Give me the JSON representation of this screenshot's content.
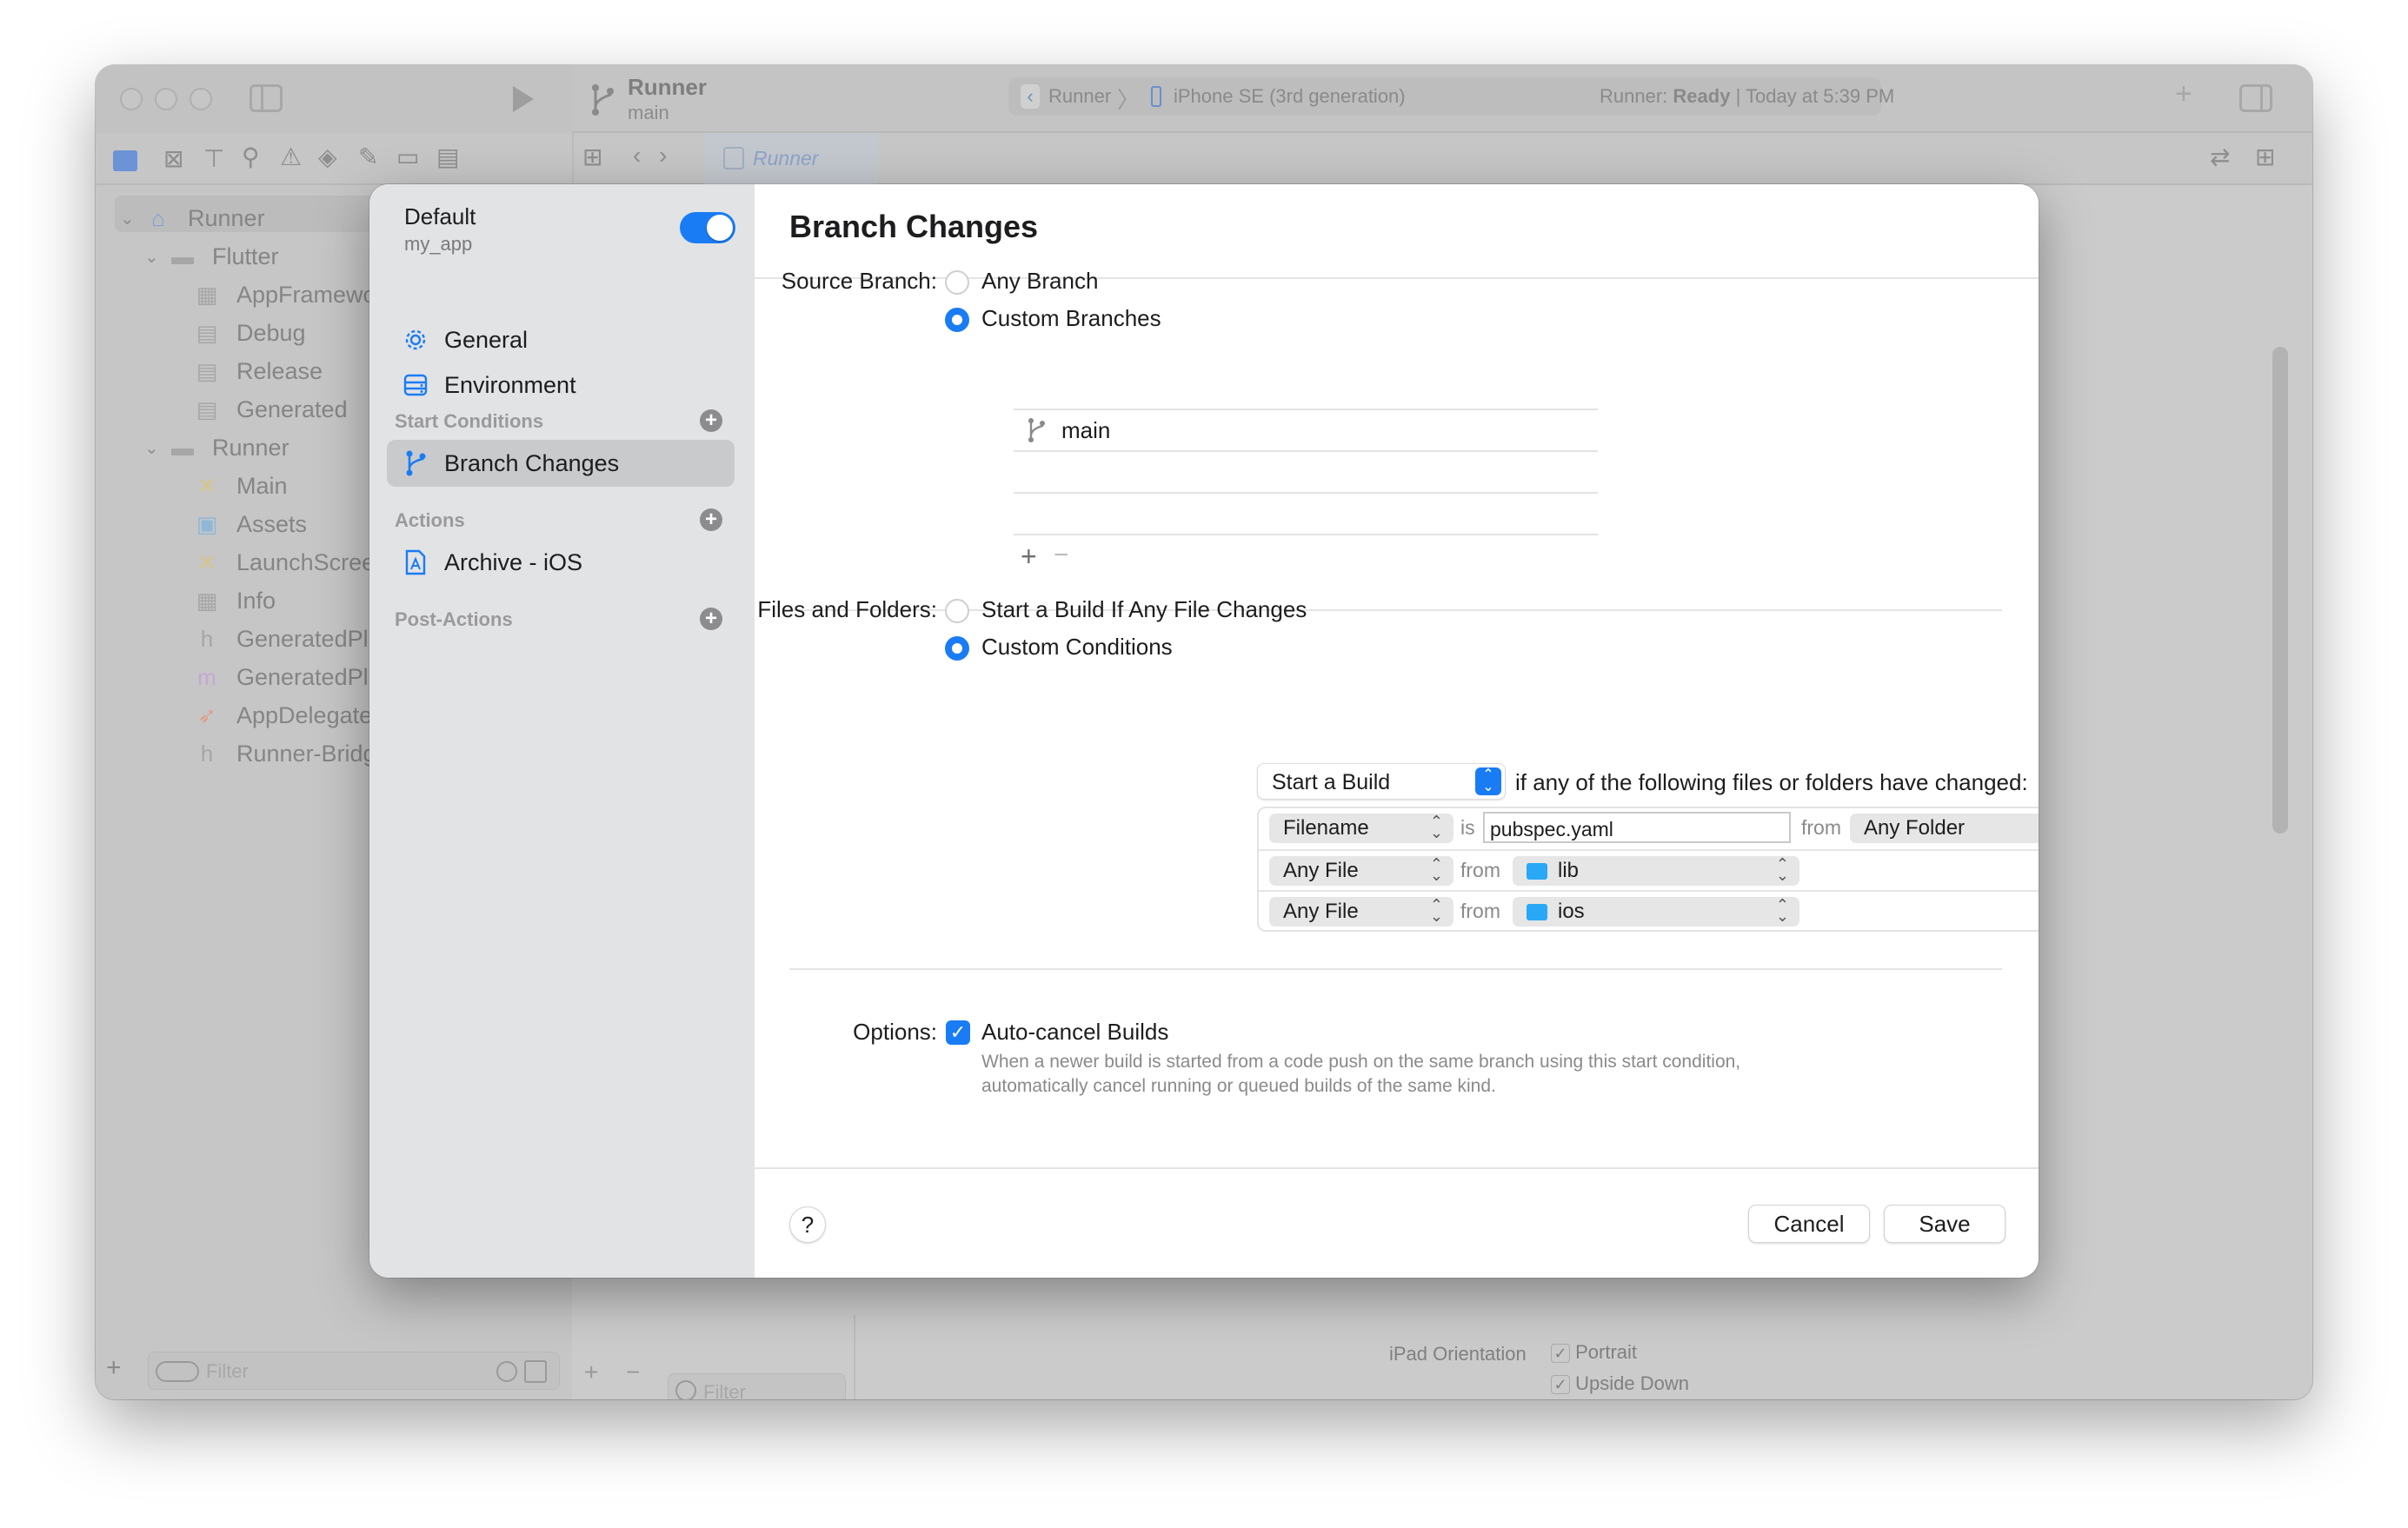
{
  "window": {
    "scheme": {
      "name": "Runner",
      "branch": "main"
    },
    "activity": {
      "target": "Runner",
      "device": "iPhone SE (3rd generation)",
      "status_prefix": "Runner:",
      "status": "Ready",
      "separator": "|",
      "timestamp": "Today at 5:39 PM"
    },
    "editor_tab": "Runner",
    "navigator": {
      "items": [
        {
          "label": "Runner",
          "icon": "app-project-icon",
          "level": 0,
          "expanded": true
        },
        {
          "label": "Flutter",
          "icon": "folder-icon",
          "level": 1,
          "expanded": true
        },
        {
          "label": "AppFramework",
          "icon": "plist-icon",
          "level": 2
        },
        {
          "label": "Debug",
          "icon": "config-file-icon",
          "level": 2
        },
        {
          "label": "Release",
          "icon": "config-file-icon",
          "level": 2
        },
        {
          "label": "Generated",
          "icon": "config-file-icon",
          "level": 2
        },
        {
          "label": "Runner",
          "icon": "folder-icon",
          "level": 1,
          "expanded": true
        },
        {
          "label": "Main",
          "icon": "storyboard-icon",
          "level": 2
        },
        {
          "label": "Assets",
          "icon": "assets-icon",
          "level": 2
        },
        {
          "label": "LaunchScreen",
          "icon": "storyboard-icon",
          "level": 2
        },
        {
          "label": "Info",
          "icon": "plist-icon",
          "level": 2
        },
        {
          "label": "GeneratedPlu",
          "icon": "header-file-icon",
          "level": 2
        },
        {
          "label": "GeneratedPlu",
          "icon": "objc-file-icon",
          "level": 2
        },
        {
          "label": "AppDelegate",
          "icon": "swift-file-icon",
          "level": 2
        },
        {
          "label": "Runner-Bridg",
          "icon": "header-file-icon",
          "level": 2
        }
      ],
      "filter_placeholder": "Filter"
    },
    "editor_filter_placeholder": "Filter",
    "background_settings": {
      "label": "iPad Orientation",
      "options": [
        {
          "label": "Portrait",
          "checked": true
        },
        {
          "label": "Upside Down",
          "checked": true
        }
      ]
    }
  },
  "dialog": {
    "workflow": {
      "name": "Default",
      "product": "my_app",
      "enabled": true
    },
    "sidebar": {
      "items": [
        {
          "label": "General",
          "icon": "gear-icon"
        },
        {
          "label": "Environment",
          "icon": "environment-icon"
        }
      ],
      "sections": [
        {
          "title": "Start Conditions",
          "items": [
            {
              "label": "Branch Changes",
              "icon": "branch-icon",
              "selected": true
            }
          ]
        },
        {
          "title": "Actions",
          "items": [
            {
              "label": "Archive - iOS",
              "icon": "archive-app-icon"
            }
          ]
        },
        {
          "title": "Post-Actions",
          "items": []
        }
      ]
    },
    "title": "Branch Changes",
    "source_branch": {
      "label": "Source Branch:",
      "options": [
        {
          "label": "Any Branch",
          "selected": false
        },
        {
          "label": "Custom Branches",
          "selected": true
        }
      ],
      "branches": [
        "main"
      ],
      "add_label": "+",
      "remove_label": "−"
    },
    "files_and_folders": {
      "label": "Files and Folders:",
      "options": [
        {
          "label": "Start a Build If Any File Changes",
          "selected": false
        },
        {
          "label": "Custom Conditions",
          "selected": true
        }
      ],
      "action_popup": "Start a Build",
      "action_suffix": "if any of the following files or folders have changed:",
      "conditions": [
        {
          "type": "Filename",
          "op": "is",
          "value": "pubspec.yaml",
          "from_label": "from",
          "folder": "Any Folder",
          "folder_icon": false
        },
        {
          "type": "Any File",
          "from_label": "from",
          "folder": "lib",
          "folder_icon": true
        },
        {
          "type": "Any File",
          "from_label": "from",
          "folder": "ios",
          "folder_icon": true
        }
      ],
      "row_remove": "−",
      "row_add": "+"
    },
    "options": {
      "label": "Options:",
      "auto_cancel": {
        "label": "Auto-cancel Builds",
        "checked": true,
        "description": "When a newer build is started from a code push on the same branch using this start condition, automatically cancel running or queued builds of the same kind."
      }
    },
    "footer": {
      "help": "?",
      "cancel": "Cancel",
      "save": "Save"
    },
    "colors": {
      "accent": "#1a7cf5",
      "folder": "#29a8f5"
    }
  }
}
